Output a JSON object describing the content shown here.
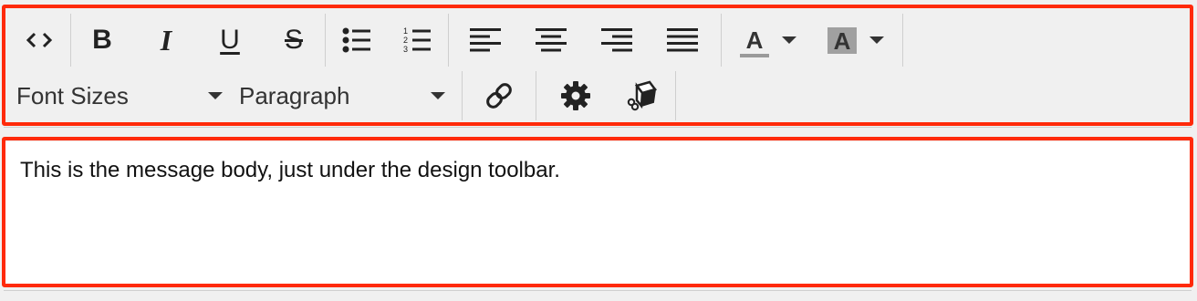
{
  "toolbar": {
    "source_icon": "code-icon",
    "bold_label": "B",
    "italic_label": "I",
    "underline_label": "U",
    "strike_label": "S",
    "bullet_list_icon": "bullet-list-icon",
    "numbered_list_icon": "numbered-list-icon",
    "align_left_icon": "align-left-icon",
    "align_center_icon": "align-center-icon",
    "align_right_icon": "align-right-icon",
    "justify_icon": "align-justify-icon",
    "text_color_label": "A",
    "bg_color_label": "A",
    "font_sizes_label": "Font Sizes",
    "paragraph_label": "Paragraph",
    "link_icon": "link-icon",
    "settings_icon": "gear-icon",
    "plugin_icon": "plugin-box-icon"
  },
  "editor": {
    "body_text": "This is the message body, just under the design toolbar."
  },
  "colors": {
    "highlight": "#ff2a0a",
    "toolbar_bg": "#f0f0f0",
    "body_bg": "#ffffff"
  }
}
